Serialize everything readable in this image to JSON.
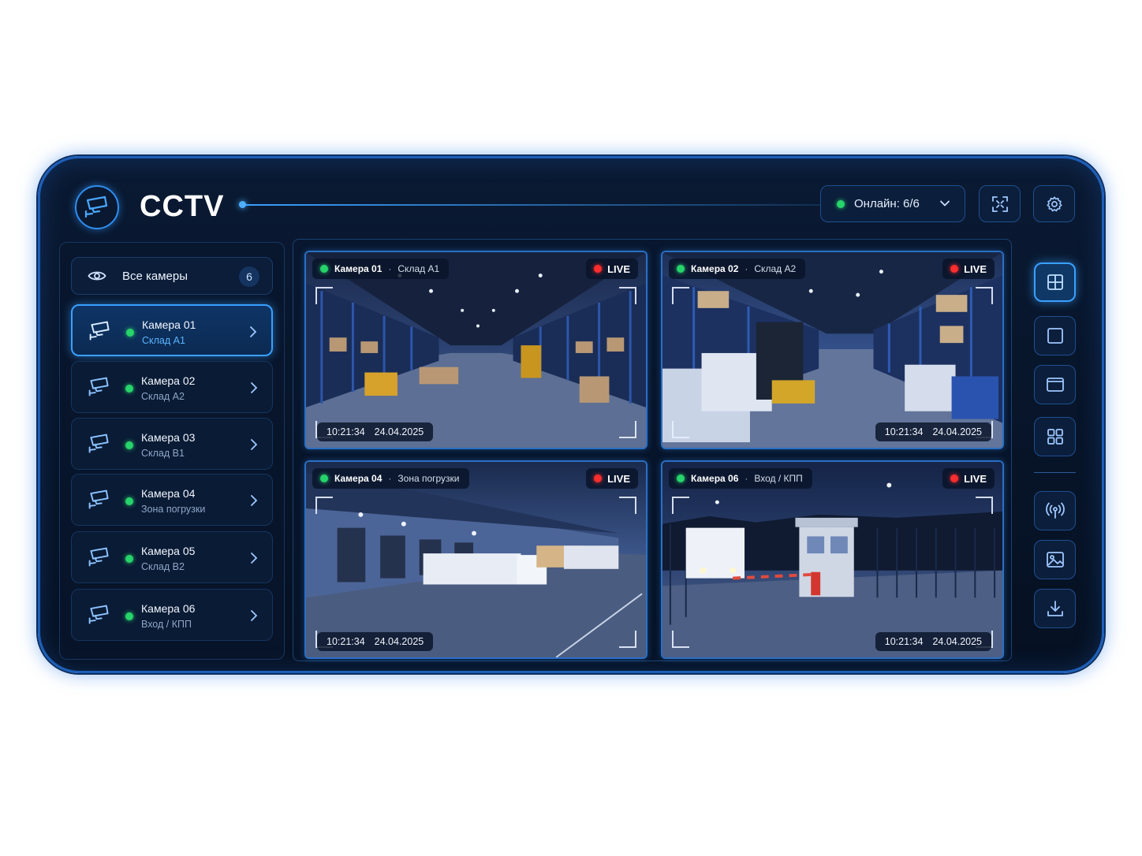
{
  "header": {
    "title": "CCTV",
    "status": {
      "label": "Онлайн: 6/6",
      "color": "#27d36b"
    }
  },
  "sidebar": {
    "all_cameras": {
      "label": "Все камеры",
      "count": "6"
    },
    "cameras": [
      {
        "name": "Камера 01",
        "location": "Склад А1",
        "active": true
      },
      {
        "name": "Камера 02",
        "location": "Склад А2",
        "active": false
      },
      {
        "name": "Камера 03",
        "location": "Склад В1",
        "active": false
      },
      {
        "name": "Камера 04",
        "location": "Зона погрузки",
        "active": false
      },
      {
        "name": "Камера 05",
        "location": "Склад В2",
        "active": false
      },
      {
        "name": "Камера 06",
        "location": "Вход / КПП",
        "active": false
      }
    ]
  },
  "grid": {
    "live_label": "LIVE",
    "tiles": [
      {
        "camera": "Камера 01",
        "zone": "Склад А1",
        "time": "10:21:34",
        "date": "24.04.2025",
        "scene": "warehouse aisle with forklift"
      },
      {
        "camera": "Камера 02",
        "zone": "Склад А2",
        "time": "10:21:34",
        "date": "24.04.2025",
        "scene": "warehouse with pallets and forklift"
      },
      {
        "camera": "Камера 04",
        "zone": "Зона погрузки",
        "time": "10:21:34",
        "date": "24.04.2025",
        "scene": "loading docks with trucks at night"
      },
      {
        "camera": "Камера 06",
        "zone": "Вход / КПП",
        "time": "10:21:34",
        "date": "24.04.2025",
        "scene": "entrance checkpoint with barrier and truck"
      }
    ]
  },
  "colors": {
    "accent": "#3aa0ff",
    "online": "#27d36b",
    "live": "#ff2d2d",
    "background": "#071428"
  },
  "icons": {
    "logo": "cctv-camera-icon",
    "fullscreen": "fullscreen-icon",
    "settings": "gear-icon",
    "layouts": [
      "grid-2x2-icon",
      "single-view-icon",
      "window-view-icon",
      "grid-4-icon"
    ],
    "tools": [
      "broadcast-icon",
      "image-icon",
      "download-icon"
    ]
  }
}
